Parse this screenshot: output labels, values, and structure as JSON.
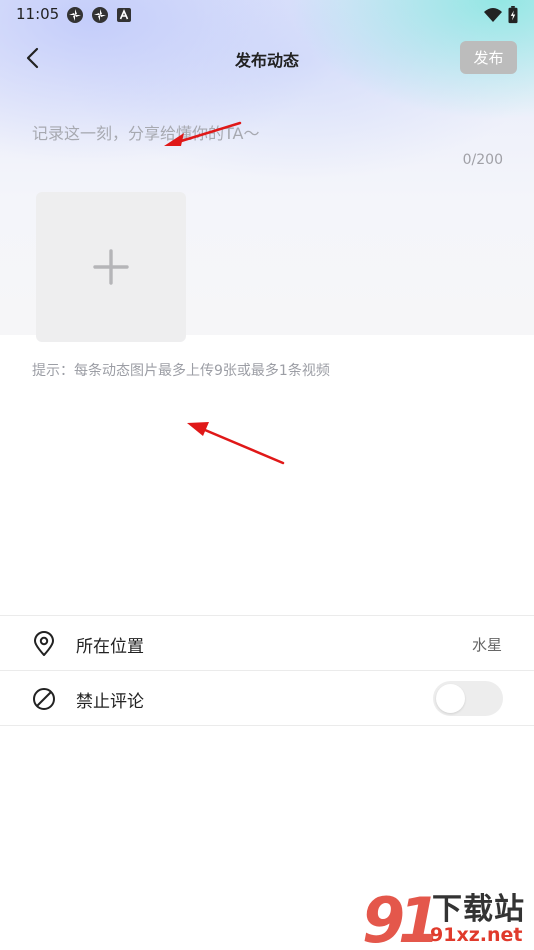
{
  "status_bar": {
    "time": "11:05"
  },
  "nav": {
    "title": "发布动态",
    "publish_label": "发布"
  },
  "composer": {
    "placeholder": "记录这一刻，分享给懂你的TA～",
    "counter": "0/200",
    "hint": "提示：每条动态图片最多上传9张或最多1条视频"
  },
  "settings": {
    "location": {
      "label": "所在位置",
      "value": "水星"
    },
    "disable_comments": {
      "label": "禁止评论",
      "enabled": false
    }
  },
  "watermark": {
    "brand": "下载站",
    "domain": "91xz.net"
  },
  "colors": {
    "publish_disabled": "#bcbcbc",
    "annotation_arrow": "#e01818",
    "watermark_red": "#e03a2c"
  }
}
